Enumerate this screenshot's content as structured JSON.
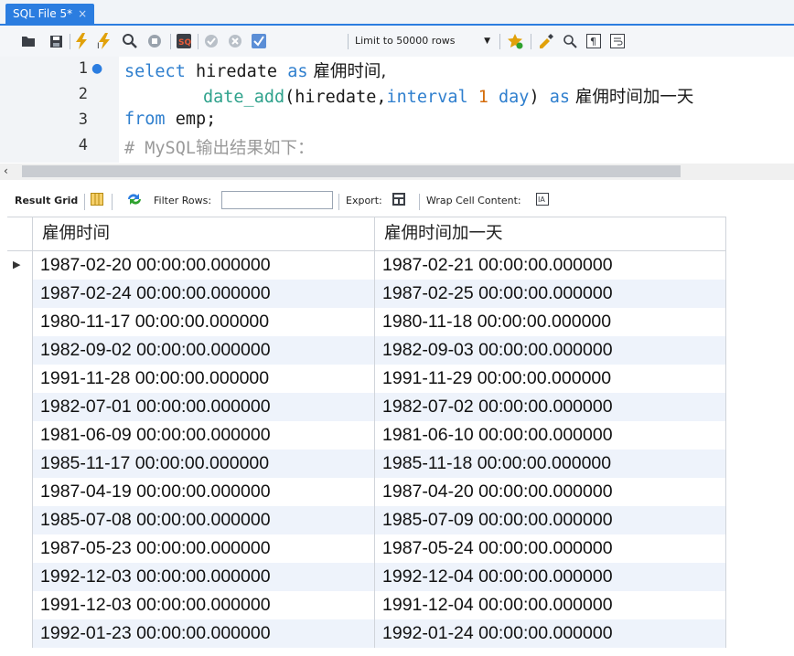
{
  "tab": {
    "title": "SQL File 5*",
    "close": "×"
  },
  "toolbar": {
    "limit_label": "Limit to 50000 rows"
  },
  "editor": {
    "line_numbers": [
      "1",
      "2",
      "3",
      "4"
    ],
    "line1": {
      "kw1": "select",
      "rest1": " hiredate ",
      "kw2": "as",
      "alias": " 雇佣时间,"
    },
    "line2": {
      "fn": "date_add",
      "open": "(hiredate,",
      "kw": "interval",
      "sp": " ",
      "num": "1",
      "sp2": " ",
      "unit": "day",
      "close": ") ",
      "kw2": "as",
      "alias": " 雇佣时间加一天"
    },
    "line3": {
      "kw": "from",
      "rest": " emp;"
    },
    "line4": {
      "comment": "# MySQL输出结果如下："
    }
  },
  "result_toolbar": {
    "result_grid": "Result Grid",
    "filter_rows": "Filter Rows:",
    "filter_value": "",
    "export": "Export:",
    "wrap": "Wrap Cell Content:"
  },
  "grid": {
    "columns": [
      "雇佣时间",
      "雇佣时间加一天"
    ],
    "rows": [
      [
        "1987-02-20 00:00:00.000000",
        "1987-02-21 00:00:00.000000"
      ],
      [
        "1987-02-24 00:00:00.000000",
        "1987-02-25 00:00:00.000000"
      ],
      [
        "1980-11-17 00:00:00.000000",
        "1980-11-18 00:00:00.000000"
      ],
      [
        "1982-09-02 00:00:00.000000",
        "1982-09-03 00:00:00.000000"
      ],
      [
        "1991-11-28 00:00:00.000000",
        "1991-11-29 00:00:00.000000"
      ],
      [
        "1982-07-01 00:00:00.000000",
        "1982-07-02 00:00:00.000000"
      ],
      [
        "1981-06-09 00:00:00.000000",
        "1981-06-10 00:00:00.000000"
      ],
      [
        "1985-11-17 00:00:00.000000",
        "1985-11-18 00:00:00.000000"
      ],
      [
        "1987-04-19 00:00:00.000000",
        "1987-04-20 00:00:00.000000"
      ],
      [
        "1985-07-08 00:00:00.000000",
        "1985-07-09 00:00:00.000000"
      ],
      [
        "1987-05-23 00:00:00.000000",
        "1987-05-24 00:00:00.000000"
      ],
      [
        "1992-12-03 00:00:00.000000",
        "1992-12-04 00:00:00.000000"
      ],
      [
        "1991-12-03 00:00:00.000000",
        "1991-12-04 00:00:00.000000"
      ],
      [
        "1992-01-23 00:00:00.000000",
        "1992-01-24 00:00:00.000000"
      ]
    ]
  },
  "colors": {
    "accent": "#2b7de0",
    "keyword": "#2f7fce",
    "number": "#d46b08",
    "comment": "#9a9a9a",
    "alt_row": "#eef3fb"
  }
}
